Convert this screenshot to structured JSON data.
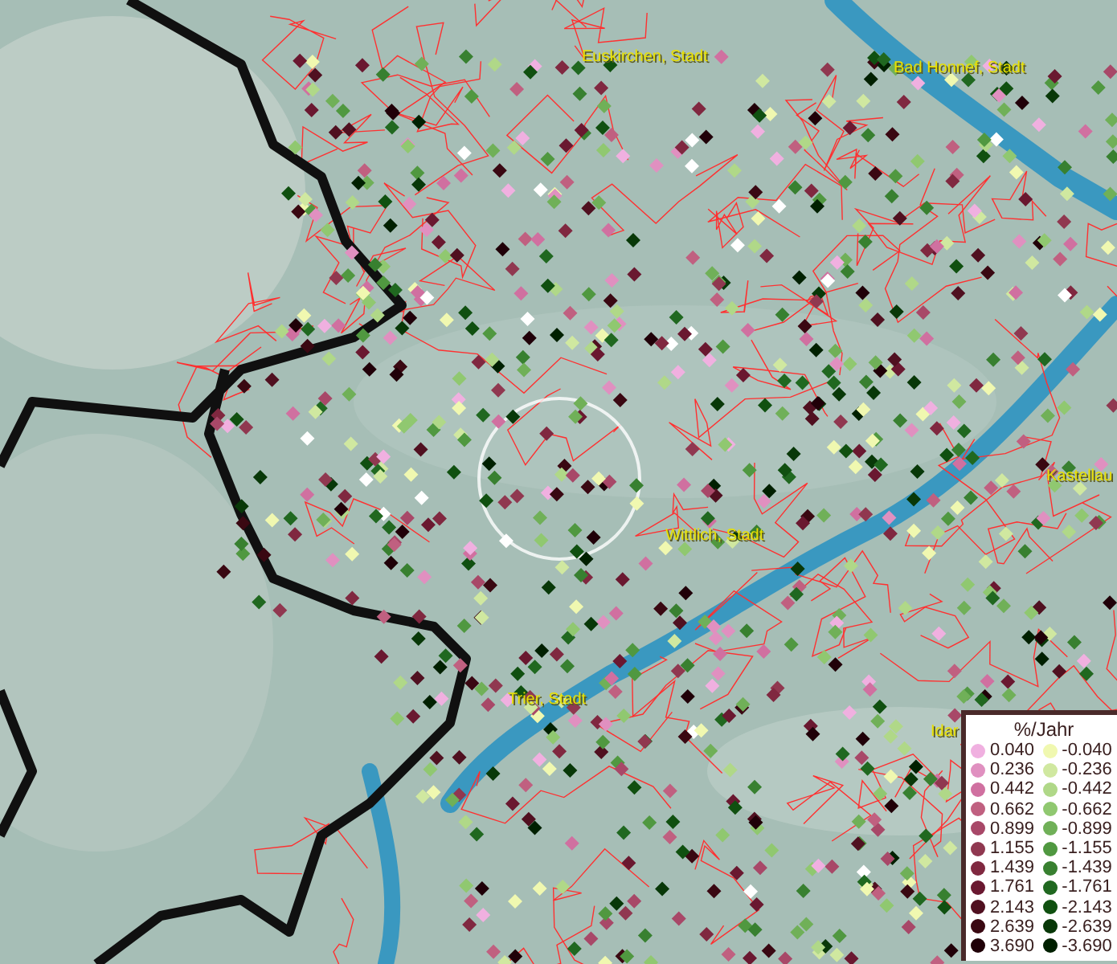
{
  "places": [
    {
      "name": "Euskirchen, Stadt"
    },
    {
      "name": "Bad Honnef, Stadt"
    },
    {
      "name": "Kastellau"
    },
    {
      "name": "Wittlich, Stadt"
    },
    {
      "name": "Trier, Stadt"
    },
    {
      "name": "Idar"
    }
  ],
  "legend": {
    "title": "%/Jahr",
    "columns": [
      [
        {
          "label": "0.040",
          "color": "#f0b0e0"
        },
        {
          "label": "0.236",
          "color": "#e090c0"
        },
        {
          "label": "0.442",
          "color": "#d070a0"
        },
        {
          "label": "0.662",
          "color": "#c06080"
        },
        {
          "label": "0.899",
          "color": "#a84868"
        },
        {
          "label": "1.155",
          "color": "#903850"
        },
        {
          "label": "1.439",
          "color": "#802840"
        },
        {
          "label": "1.761",
          "color": "#6a1830"
        },
        {
          "label": "2.143",
          "color": "#501020"
        },
        {
          "label": "2.639",
          "color": "#3a0812"
        },
        {
          "label": "3.690",
          "color": "#200008"
        }
      ],
      [
        {
          "label": "-0.040",
          "color": "#f0f8b0"
        },
        {
          "label": "-0.236",
          "color": "#d0e8a0"
        },
        {
          "label": "-0.442",
          "color": "#b0d888"
        },
        {
          "label": "-0.662",
          "color": "#90c870"
        },
        {
          "label": "-0.899",
          "color": "#70b058"
        },
        {
          "label": "-1.155",
          "color": "#509840"
        },
        {
          "label": "-1.439",
          "color": "#388030"
        },
        {
          "label": "-1.761",
          "color": "#206820"
        },
        {
          "label": "-2.143",
          "color": "#105010"
        },
        {
          "label": "-2.639",
          "color": "#083808"
        },
        {
          "label": "-3.690",
          "color": "#002000"
        }
      ]
    ]
  }
}
